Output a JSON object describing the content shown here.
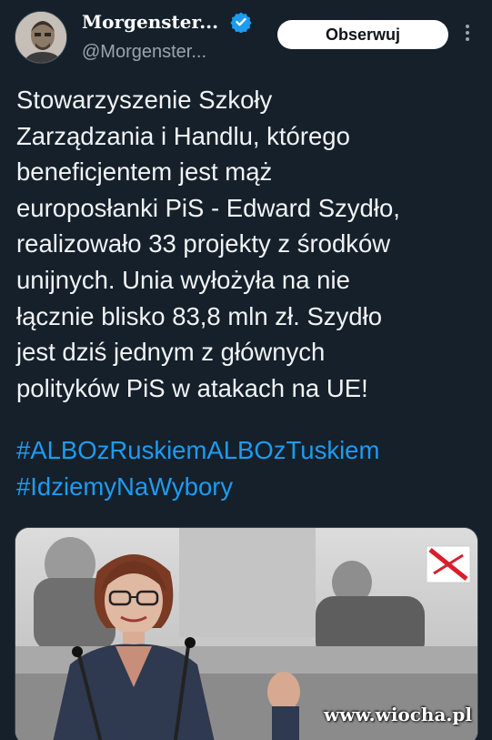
{
  "author": {
    "display_name": "Morgenster...",
    "handle": "@Morgenster..."
  },
  "follow_label": "Obserwuj",
  "tweet": {
    "text": "Stowarzyszenie Szkoły\nZarządzania i Handlu, którego\nbeneficjentem jest mąż\neuroposłanki PiS - Edward Szydło,\nrealizowało 33 projekty z środków\nunijnych. Unia wyłożyła na nie\nłącznie blisko 83,8 mln zł.  Szydło\njest dziś jednym z głównych\npolityków PiS w atakach na UE!",
    "hashtags": [
      "#ALBOzRuskiemALBOzTuskiem",
      "#IdziemyNaWybory"
    ]
  },
  "watermark": "www.wiocha.pl",
  "icons": {
    "verified": "verified-badge-icon",
    "more": "more-options-icon"
  },
  "colors": {
    "background": "#15202b",
    "link": "#1d9bf0",
    "verified": "#1d9bf0",
    "button_bg": "#ffffff"
  }
}
